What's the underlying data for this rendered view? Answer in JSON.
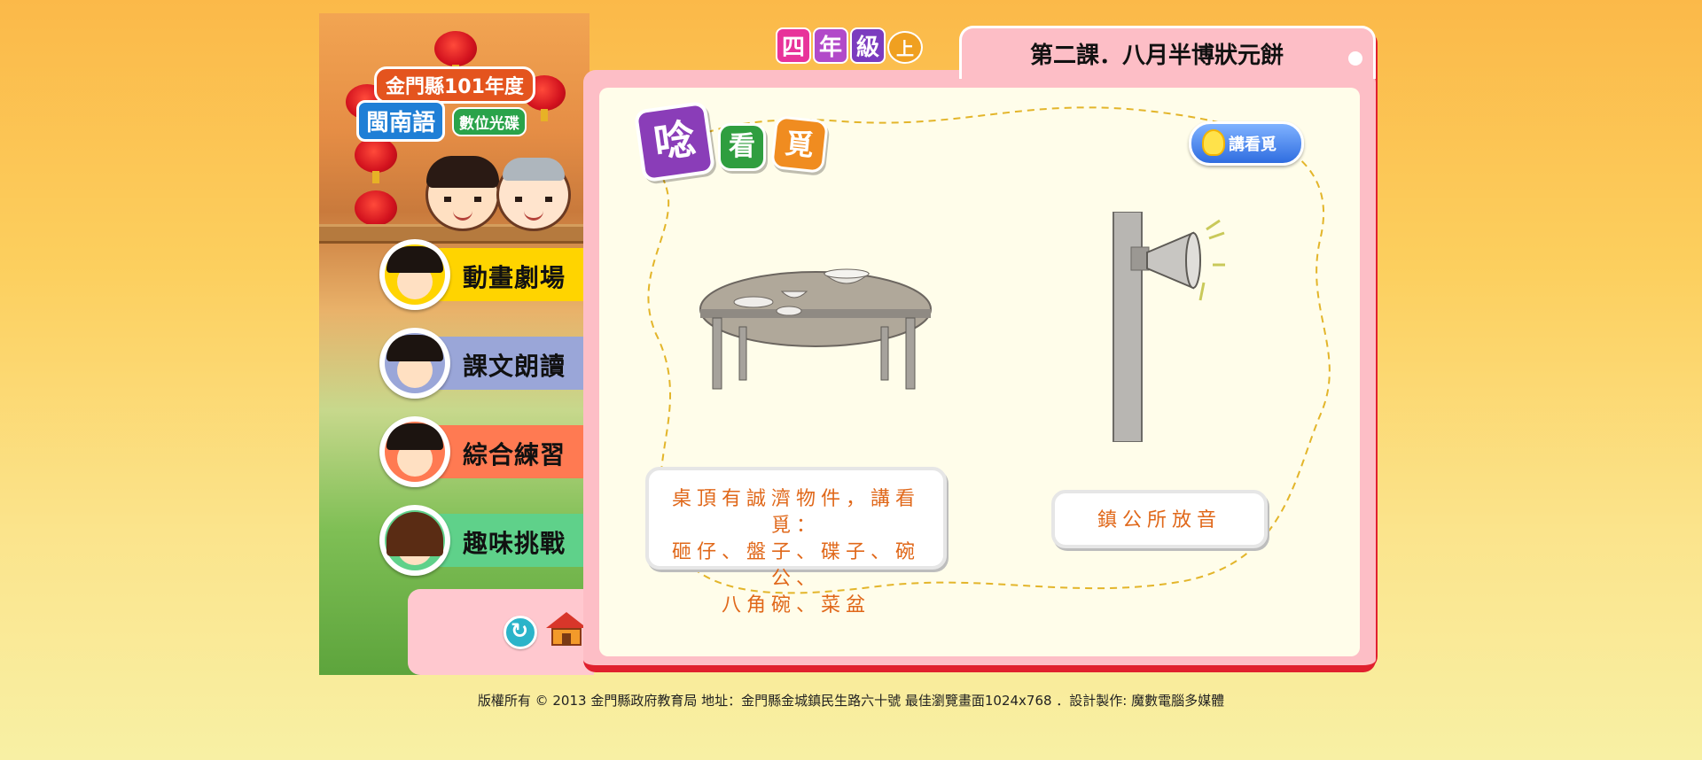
{
  "logo": {
    "line1": "金門縣101年度",
    "line2": "閩南語",
    "line3": "數位光碟"
  },
  "grade_badge": [
    "四",
    "年",
    "級",
    "上"
  ],
  "lesson_title": "第二課．八月半博狀元餅",
  "nav": {
    "items": [
      {
        "label": "動畫劇場",
        "color": "#ffd400"
      },
      {
        "label": "課文朗讀",
        "color": "#9aa6d8"
      },
      {
        "label": "綜合練習",
        "color": "#ff7a52"
      },
      {
        "label": "趣味挑戰",
        "color": "#5fd18a"
      }
    ]
  },
  "section_title": [
    "唸",
    "看",
    "覓"
  ],
  "speak_button": "講看覓",
  "captions": {
    "left": {
      "line1": "桌頂有誠濟物件，講看覓：",
      "line2": "砸仔、盤子、碟子、碗公、",
      "line3": "八角碗、菜盆"
    },
    "right": "鎮公所放音"
  },
  "footer": "版權所有 © 2013 金門縣政府教育局 地址：金門縣金城鎮民生路六十號 最佳瀏覽畫面1024x768 ．設計製作: 魔數電腦多媒體"
}
